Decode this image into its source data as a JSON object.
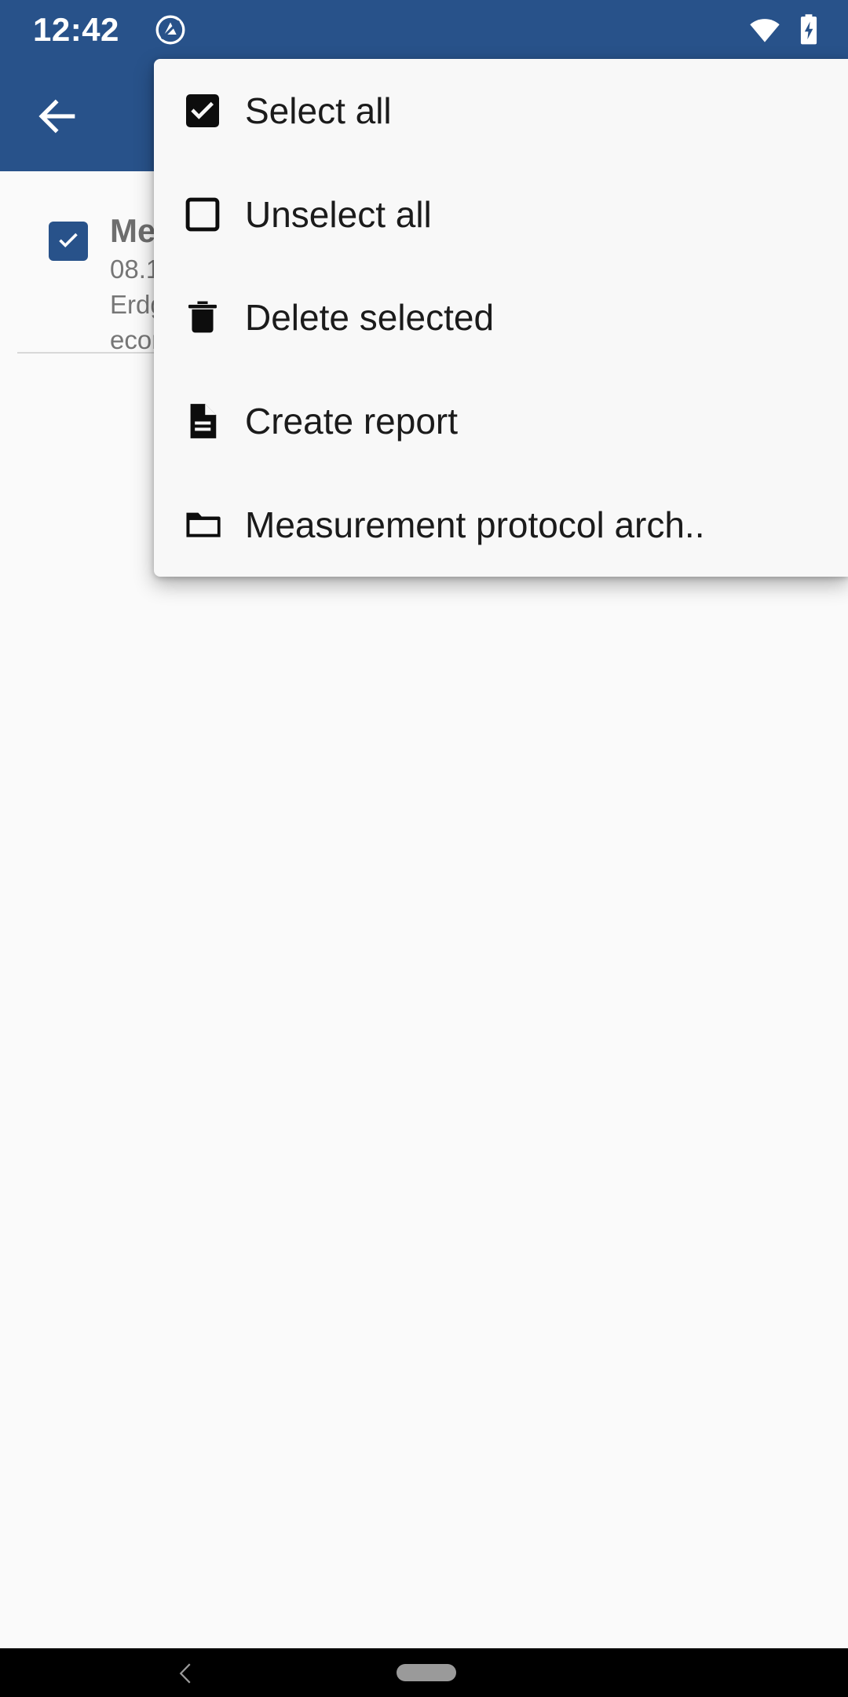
{
  "status_bar": {
    "time": "12:42",
    "dnd_icon": "do-not-disturb-icon",
    "wifi_icon": "wifi-icon",
    "battery_icon": "battery-charging-icon",
    "background_color": "#28528a",
    "foreground_color": "#ffffff"
  },
  "app_bar": {
    "back_icon": "arrow-back-icon",
    "background_color": "#28528a"
  },
  "list": {
    "items": [
      {
        "checked": true,
        "title": "Me",
        "line1": "08.1",
        "line2": "Erdg",
        "line3": "econ"
      }
    ],
    "checkbox_color": "#28528a"
  },
  "menu": {
    "background_color": "#f8f8f8",
    "items": [
      {
        "icon": "checkbox-checked-icon",
        "label": "Select all"
      },
      {
        "icon": "checkbox-unchecked-icon",
        "label": "Unselect all"
      },
      {
        "icon": "trash-icon",
        "label": "Delete selected"
      },
      {
        "icon": "document-icon",
        "label": "Create report"
      },
      {
        "icon": "folder-icon",
        "label": "Measurement protocol arch.."
      }
    ]
  },
  "nav_bar": {
    "background_color": "#000000",
    "back_icon": "chevron-back-icon",
    "home_icon": "home-pill-icon"
  }
}
